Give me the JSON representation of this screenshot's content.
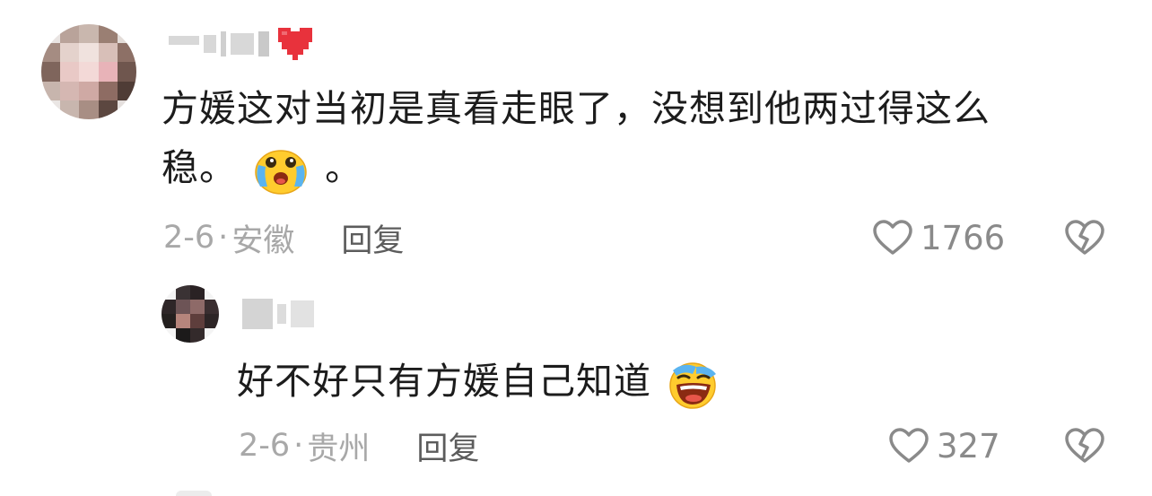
{
  "comments": [
    {
      "username": "",
      "text_line1": "方媛这对当初是真看走眼了，没想到他两过得这么",
      "text_line2_a": "稳。",
      "text_line2_b": "。",
      "date": "2-6",
      "location": "安徽",
      "reply_label": "回复",
      "likes": "1766",
      "emoji": "crying-face"
    },
    {
      "username": "",
      "text": "好不好只有方媛自己知道",
      "date": "2-6",
      "location": "贵州",
      "reply_label": "回复",
      "likes": "327",
      "emoji": "laughing-crying-face"
    }
  ],
  "separator": "·",
  "colors": {
    "heart_badge": "#e8323c",
    "text": "#1c1c1c",
    "meta": "#a8a8a8",
    "reply": "#5c5c5c"
  }
}
